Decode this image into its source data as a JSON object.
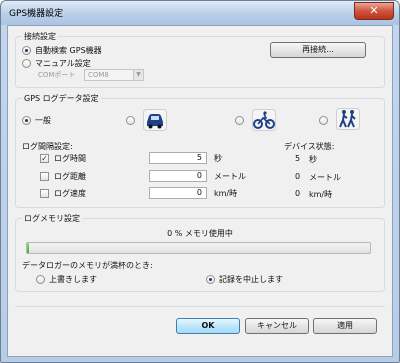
{
  "window": {
    "title": "GPS機器設定",
    "close_glyph": "✕"
  },
  "connection": {
    "legend": "接続設定",
    "auto_label": "自動検索 GPS機器",
    "manual_label": "マニュアル設定",
    "comport_label": "COMポート",
    "comport_value": "COM8",
    "reconnect_label": "再接続..."
  },
  "log_data": {
    "legend": "GPS ログデータ設定",
    "general_label": "一般",
    "modes": [
      {
        "icon": "car-icon",
        "selected": false
      },
      {
        "icon": "bicycle-icon",
        "selected": false
      },
      {
        "icon": "hikers-icon",
        "selected": false
      }
    ],
    "interval_heading": "ログ間隔設定:",
    "device_status_heading": "デバイス状態:",
    "rows": [
      {
        "label": "ログ時間",
        "checked": true,
        "value": "5",
        "unit": "秒",
        "status_value": "5",
        "status_unit": "秒"
      },
      {
        "label": "ログ距離",
        "checked": false,
        "value": "0",
        "unit": "メートル",
        "status_value": "0",
        "status_unit": "メートル"
      },
      {
        "label": "ログ速度",
        "checked": false,
        "value": "0",
        "unit": "km/時",
        "status_value": "0",
        "status_unit": "km/時"
      }
    ]
  },
  "memory": {
    "legend": "ログメモリ設定",
    "usage_text": "0 % メモリ使用中",
    "usage_percent": 0,
    "full_question": "データロガーのメモリが満杯のとき:",
    "overwrite_label": "上書きします",
    "stop_label": "記録を中止します"
  },
  "footer": {
    "ok_label": "OK",
    "cancel_label": "キャンセル",
    "apply_label": "適用"
  },
  "colors": {
    "accent": "#3c7fb1",
    "progress": "#2fb52f",
    "close": "#c9452b"
  }
}
